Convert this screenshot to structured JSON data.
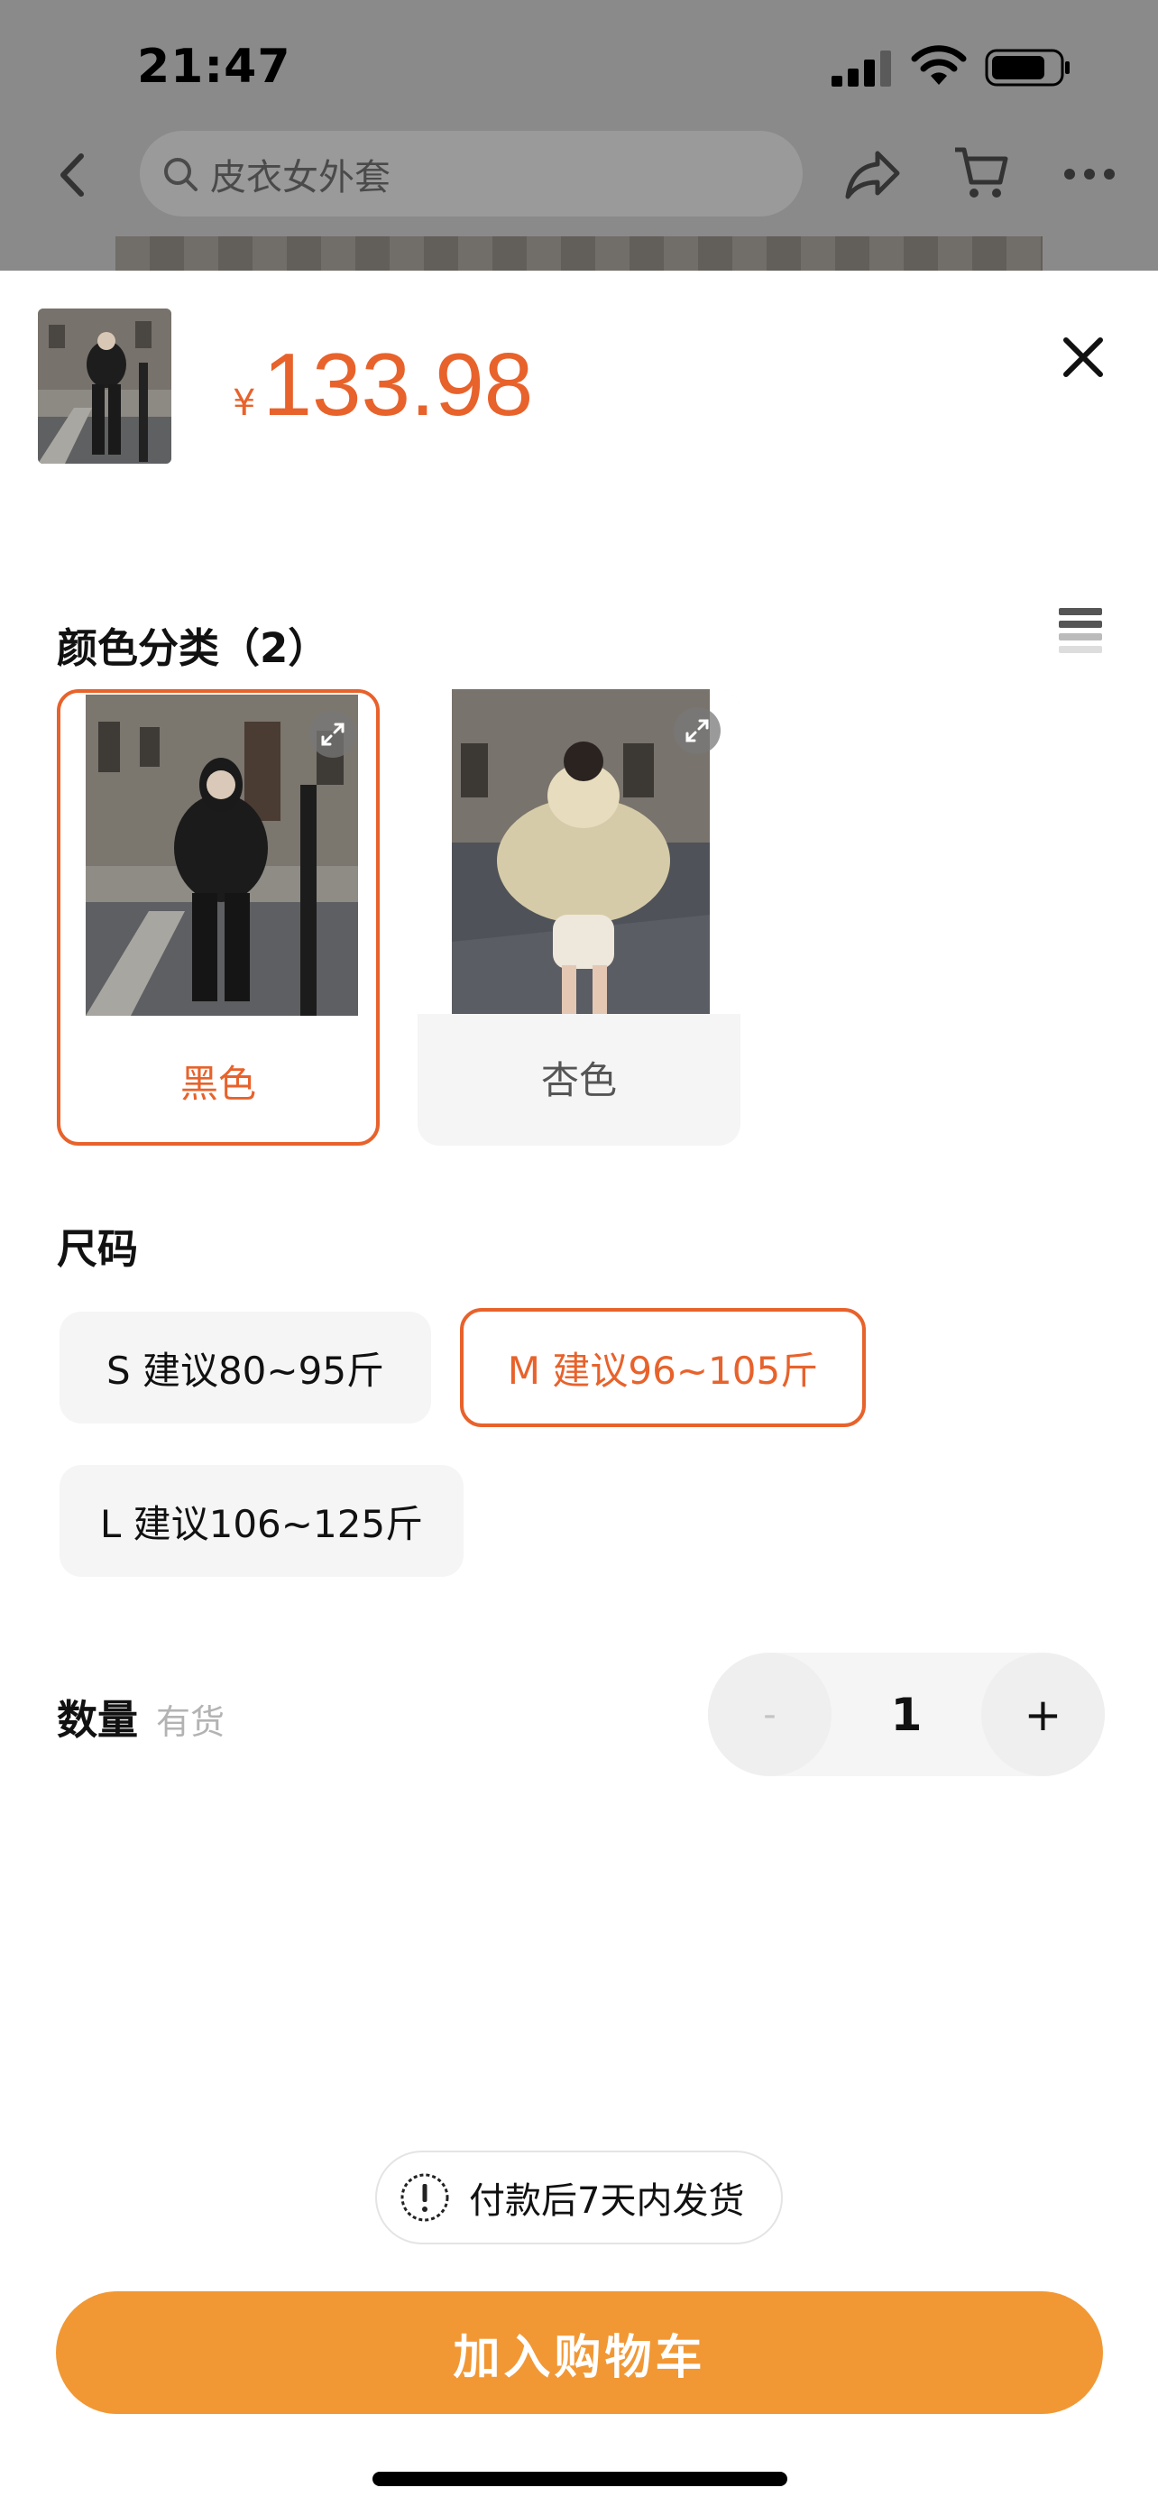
{
  "status_bar": {
    "time": "21:47"
  },
  "nav": {
    "search_placeholder": "皮衣女外套"
  },
  "product": {
    "currency": "¥",
    "price": "133.98"
  },
  "color_section": {
    "title": "颜色分类（2）",
    "options": [
      {
        "label": "黑色",
        "selected": true
      },
      {
        "label": "杏色",
        "selected": false
      }
    ]
  },
  "size_section": {
    "title": "尺码",
    "options": [
      {
        "label": "S 建议80~95斤",
        "selected": false
      },
      {
        "label": "M 建议96~105斤",
        "selected": true
      },
      {
        "label": "L 建议106~125斤",
        "selected": false
      }
    ]
  },
  "quantity": {
    "title": "数量",
    "stock": "有货",
    "minus": "-",
    "value": "1",
    "plus": "+"
  },
  "shipping_note": "付款后7天内发货",
  "add_to_cart": "加入购物车",
  "colors": {
    "accent": "#e8622b",
    "cta": "#f19834",
    "chip_bg": "#f5f5f5"
  }
}
